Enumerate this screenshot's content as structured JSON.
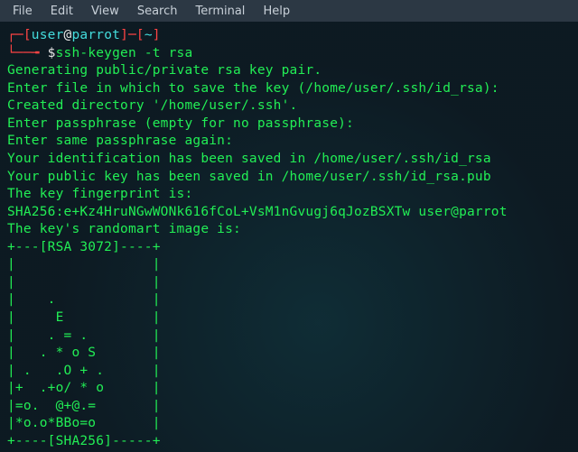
{
  "menubar": {
    "file": "File",
    "edit": "Edit",
    "view": "View",
    "search": "Search",
    "terminal": "Terminal",
    "help": "Help"
  },
  "prompt": {
    "br_open": "┌─[",
    "user": "user",
    "at": "@",
    "host": "parrot",
    "br_close": "]─[",
    "tilde": "~",
    "br_end": "]",
    "l2_prefix": "└──╼ ",
    "dollar": "$",
    "command": "ssh-keygen -t rsa"
  },
  "output": {
    "l1": "Generating public/private rsa key pair.",
    "l2": "Enter file in which to save the key (/home/user/.ssh/id_rsa):",
    "l3": "Created directory '/home/user/.ssh'.",
    "l4": "Enter passphrase (empty for no passphrase):",
    "l5": "Enter same passphrase again:",
    "l6": "Your identification has been saved in /home/user/.ssh/id_rsa",
    "l7": "Your public key has been saved in /home/user/.ssh/id_rsa.pub",
    "l8": "The key fingerprint is:",
    "l9": "SHA256:e+Kz4HruNGwWONk616fCoL+VsM1nGvugj6qJozBSXTw user@parrot",
    "l10": "The key's randomart image is:",
    "r1": "+---[RSA 3072]----+",
    "r2": "|                 |",
    "r3": "|                 |",
    "r4": "|    .            |",
    "r5": "|     E           |",
    "r6": "|    . = .        |",
    "r7": "|   . * o S       |",
    "r8": "| .   .O + .      |",
    "r9": "|+  .+o/ * o      |",
    "r10": "|=o.  @+@.=       |",
    "r11": "|*o.o*BBo=o       |",
    "r12": "+----[SHA256]-----+"
  }
}
